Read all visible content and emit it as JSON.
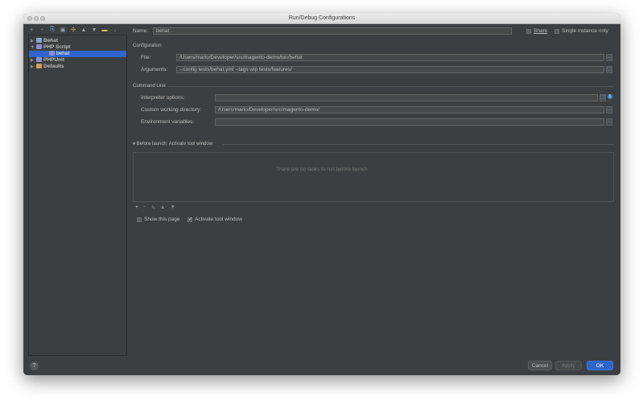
{
  "window": {
    "title": "Run/Debug Configurations"
  },
  "toolbar": {
    "icons": [
      "add-icon",
      "remove-icon",
      "copy-icon",
      "save-icon",
      "wrench-icon",
      "move-up-icon",
      "move-down-icon",
      "folder-icon",
      "sort-icon"
    ],
    "glyphs": [
      "+",
      "−",
      "⎘",
      "▣",
      "✣",
      "▲",
      "▼",
      "▬",
      "↓"
    ]
  },
  "tree": {
    "items": [
      {
        "label": "Behat",
        "arrow": "▶",
        "icon_color": "#8aa9c9"
      },
      {
        "label": "PHP Script",
        "arrow": "▼",
        "icon_color": "#8d8fd6"
      },
      {
        "label": "behat",
        "arrow": "",
        "icon_color": "#8d8fd6",
        "selected": true
      },
      {
        "label": "PHPUnit",
        "arrow": "▶",
        "icon_color": "#8d8fd6"
      },
      {
        "label": "Defaults",
        "arrow": "▶",
        "icon_color": "#c8a24e"
      }
    ]
  },
  "name": {
    "label": "Name:",
    "value": "behat"
  },
  "share": {
    "label": "Share",
    "checked": false
  },
  "single_instance": {
    "label": "Single instance only",
    "checked": false
  },
  "configuration": {
    "section": "Configuration",
    "file_label": "File:",
    "file_value": "/Users/mario/Developer/src/magento-demo/bin/behat",
    "arguments_label": "Arguments:",
    "arguments_value": "--config tests/behat.yml --tags wip tests/features/"
  },
  "command_line": {
    "section": "Command Line",
    "interpreter_label": "Interpreter options:",
    "interpreter_value": "",
    "workdir_label": "Custom working directory:",
    "workdir_value": "/Users/mario/Developer/src/magento-demo/",
    "env_label": "Environment variables:",
    "env_value": ""
  },
  "before_launch": {
    "header": "▾ Before launch: Activate tool window",
    "empty_text": "There are no tasks to run before launch",
    "tools": [
      "+",
      "−",
      "✎",
      "▲",
      "▼"
    ]
  },
  "options": {
    "show_page_label": "Show this page",
    "show_page_checked": false,
    "activate_label": "Activate tool window",
    "activate_checked": true
  },
  "buttons": {
    "cancel": "Cancel",
    "apply": "Apply",
    "ok": "OK",
    "help": "?"
  },
  "colors": {
    "background": "#3c3f41",
    "accent": "#2f65ca",
    "field": "#45494a"
  }
}
